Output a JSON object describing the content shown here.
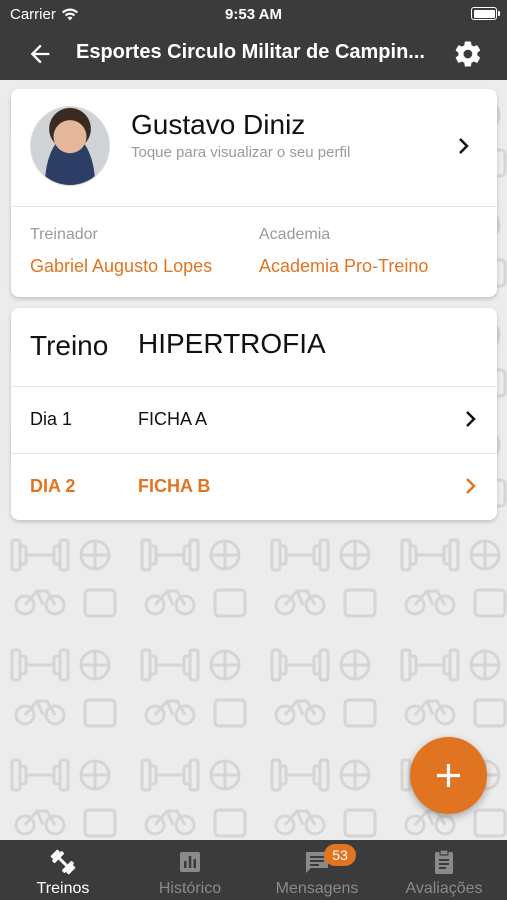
{
  "status_bar": {
    "carrier": "Carrier",
    "time": "9:53 AM"
  },
  "app_bar": {
    "title": "Esportes Circulo Militar de Campin..."
  },
  "profile": {
    "name": "Gustavo Diniz",
    "subtitle": "Toque para visualizar o seu perfil",
    "trainer_label": "Treinador",
    "trainer_value": "Gabriel Augusto Lopes",
    "gym_label": "Academia",
    "gym_value": "Academia Pro-Treino"
  },
  "workout": {
    "label": "Treino",
    "name": "HIPERTROFIA",
    "rows": [
      {
        "day": "Dia 1",
        "sheet": "FICHA A",
        "active": false
      },
      {
        "day": "DIA 2",
        "sheet": "FICHA B",
        "active": true
      }
    ]
  },
  "bottom_nav": {
    "items": [
      {
        "label": "Treinos",
        "icon": "dumbbell-icon",
        "active": true
      },
      {
        "label": "Histórico",
        "icon": "chart-icon",
        "active": false
      },
      {
        "label": "Mensagens",
        "icon": "message-icon",
        "active": false,
        "badge": "53"
      },
      {
        "label": "Avaliações",
        "icon": "clipboard-icon",
        "active": false
      }
    ]
  },
  "colors": {
    "accent": "#e07420",
    "bar": "#3b3b3b",
    "background": "#ececec"
  }
}
